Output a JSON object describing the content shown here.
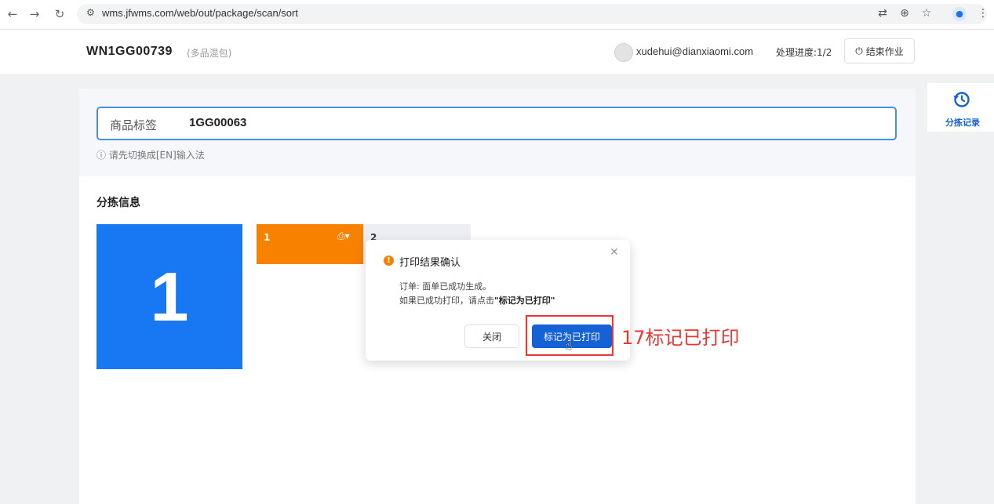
{
  "browser": {
    "url": "wms.jfwms.com/web/out/package/scan/sort",
    "back_icon": "arrow-left-icon",
    "forward_icon": "arrow-right-icon",
    "reload_icon": "reload-icon"
  },
  "header": {
    "wave_no": "WN1GG00739",
    "wave_type": "(多品混包)",
    "user_email": "xudehui@dianxiaomi.com",
    "progress": "处理进度:1/2",
    "end_button": "结束作业"
  },
  "scan": {
    "label": "商品标签",
    "value": "1GG00063",
    "hint": "请先切换成[EN]输入法"
  },
  "sorting": {
    "title": "分拣信息",
    "big_card": "1",
    "cards": [
      {
        "label": "1",
        "color": "#f98100"
      },
      {
        "label": "2",
        "color": "#eceef3"
      }
    ]
  },
  "modal": {
    "title": "打印结果确认",
    "line1": "订单: 面单已成功生成。",
    "line2_prefix": "如果已成功打印，请点击",
    "line2_emph": "\"标记为已打印\"",
    "close_button": "关闭",
    "mark_button": "标记为已打印"
  },
  "annotation": {
    "text": "17标记已打印",
    "color": "#e53935"
  },
  "side": {
    "history_label": "分拣记录"
  },
  "colors": {
    "primary": "#1561d6",
    "big_card": "#1877f2",
    "orange": "#f98100"
  }
}
